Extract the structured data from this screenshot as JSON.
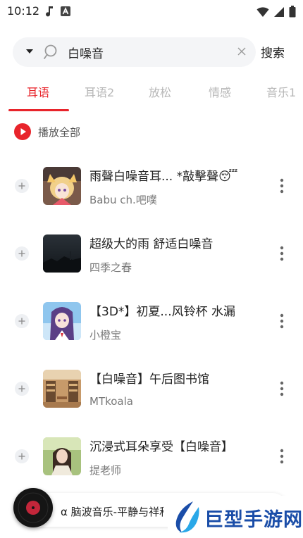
{
  "status_bar": {
    "time": "10:12"
  },
  "search": {
    "query": "白噪音",
    "button_label": "搜索"
  },
  "tabs": [
    {
      "label": "耳语",
      "active": true
    },
    {
      "label": "耳语2",
      "active": false
    },
    {
      "label": "放松",
      "active": false
    },
    {
      "label": "情感",
      "active": false
    },
    {
      "label": "音乐1",
      "active": false
    }
  ],
  "play_all": {
    "label": "播放全部"
  },
  "songs": [
    {
      "title": "雨聲白噪音耳... *敲擊聲😴",
      "artist": "Babu ch.吧噗",
      "cover": "anime-girl-cover"
    },
    {
      "title": "超级大的雨 舒适白噪音",
      "artist": "四季之春",
      "cover": "dark-rain-cover"
    },
    {
      "title": "【3D*】初夏...风铃杯 水漏",
      "artist": "小橙宝",
      "cover": "anime-girl-purple-cover"
    },
    {
      "title": "【白噪音】午后图书馆",
      "artist": "MTkoala",
      "cover": "library-cover"
    },
    {
      "title": "沉浸式耳朵享受【白噪音】",
      "artist": "提老师",
      "cover": "girl-photo-cover"
    }
  ],
  "player": {
    "now_playing": "α 脑波音乐-平静与祥和"
  },
  "watermark": {
    "text": "巨型手游网"
  },
  "colors": {
    "accent": "#e8242b",
    "tab_inactive": "#b7b7b7",
    "watermark_blue": "#1a4da8"
  }
}
